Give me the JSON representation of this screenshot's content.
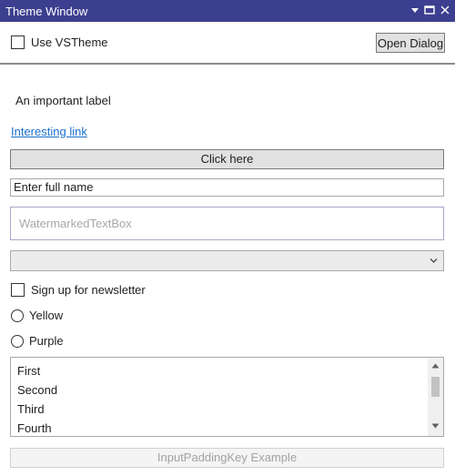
{
  "window": {
    "title": "Theme Window"
  },
  "toolbar": {
    "use_vstheme_label": "Use VSTheme",
    "use_vstheme_checked": false,
    "open_dialog_label": "Open Dialog"
  },
  "main": {
    "important_label": "An important label",
    "interesting_link": "Interesting link",
    "click_button_label": "Click here",
    "full_name_value": "Enter full name",
    "watermark_placeholder": "WatermarkedTextBox",
    "combo_selected": "",
    "newsletter_label": "Sign up for newsletter",
    "newsletter_checked": false,
    "radio_options": [
      "Yellow",
      "Purple"
    ],
    "list_items": [
      "First",
      "Second",
      "Third",
      "Fourth"
    ],
    "input_padding_button_label": "InputPaddingKey Example"
  },
  "colors": {
    "titlebar": "#3c3f8f",
    "link": "#1a6fc9"
  }
}
